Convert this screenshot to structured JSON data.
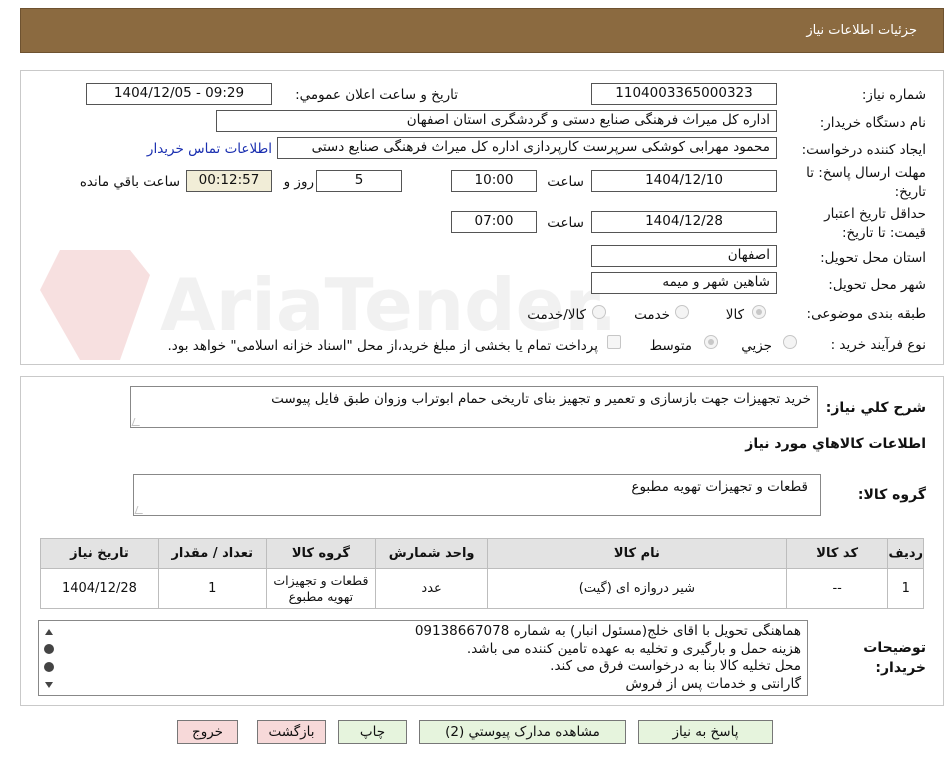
{
  "header": {
    "title": "جزئيات اطلاعات نياز"
  },
  "need": {
    "number_label": "شماره نياز:",
    "number": "1104003365000323",
    "announce_label": "تاريخ و ساعت اعلان عمومي:",
    "announce_value": "1404/12/05 - 09:29",
    "buyer_org_label": "نام دستگاه خريدار:",
    "buyer_org": "اداره کل میراث فرهنگی  صنایع دستی و گردشگری استان اصفهان",
    "creator_label": "ايجاد کننده درخواست:",
    "creator": "محمود مهرابی کوشکی سرپرست کارپردازی اداره کل میراث فرهنگی  صنایع دستی",
    "contact_link": "اطلاعات تماس خريدار",
    "deadline_label": "مهلت ارسال پاسخ: تا تاريخ:",
    "deadline_date": "1404/12/10",
    "time_word": "ساعت",
    "deadline_time": "10:00",
    "days": "5",
    "days_word": "روز و",
    "remaining": "00:12:57",
    "remaining_word": "ساعت باقي مانده",
    "validity_label": "حداقل تاريخ اعتبار قيمت: تا تاريخ:",
    "validity_date": "1404/12/28",
    "validity_time": "07:00",
    "province_label": "استان محل تحويل:",
    "province": "اصفهان",
    "city_label": "شهر محل تحويل:",
    "city": "شاهين شهر و ميمه",
    "category_label": "طبقه بندی موضوعی:",
    "category_options": [
      "کالا",
      "خدمت",
      "کالا/خدمت"
    ],
    "purchase_type_label": "نوع فرآيند خريد :",
    "purchase_options": [
      "جزيي",
      "متوسط"
    ],
    "purchase_note": "پرداخت تمام يا بخشی از مبلغ خريد،از محل \"اسناد خزانه اسلامی\" خواهد بود."
  },
  "summary": {
    "label": "شرح کلي نياز:",
    "text": "خرید تجهیزات جهت بازسازی و تعمیر و تجهیز بنای تاریخی حمام ابوتراب وزوان طبق فایل پیوست"
  },
  "goods": {
    "section_title": "اطلاعات کالاهاي مورد نياز",
    "group_label": "گروه کالا:",
    "group_value": "قطعات و تجهیزات تهویه مطبوع",
    "columns": [
      "رديف",
      "کد کالا",
      "نام کالا",
      "واحد شمارش",
      "گروه کالا",
      "تعداد / مقدار",
      "تاريخ نياز"
    ],
    "rows": [
      [
        "1",
        "--",
        "شیر دروازه ای (گیت)",
        "عدد",
        "قطعات و تجهیزات تهویه مطبوع",
        "1",
        "1404/12/28"
      ]
    ]
  },
  "buyer_notes": {
    "label": "توضيحات خريدار:",
    "lines": [
      "هماهنگی تحویل با اقای خلج(مسئول انبار) به شماره 09138667078",
      "هزینه حمل و بارگیری و تخلیه به عهده تامین کننده می باشد.",
      "محل تخلیه کالا بنا به درخواست فرق می کند.",
      "گارانتی و خدمات پس از فروش"
    ]
  },
  "buttons": {
    "reply": "پاسخ به نياز",
    "attachments": "مشاهده مدارک پيوستي (2)",
    "print": "چاپ",
    "back": "بازگشت",
    "exit": "خروج"
  },
  "watermark": {
    "brand": "AriaTender.neT"
  },
  "colors": {
    "header_bg": "#8b6a40",
    "time_bg": "#f1edd7",
    "link": "#1a2fb0",
    "btn_green": "#e6f4dd",
    "btn_pink": "#f7d9d9"
  }
}
